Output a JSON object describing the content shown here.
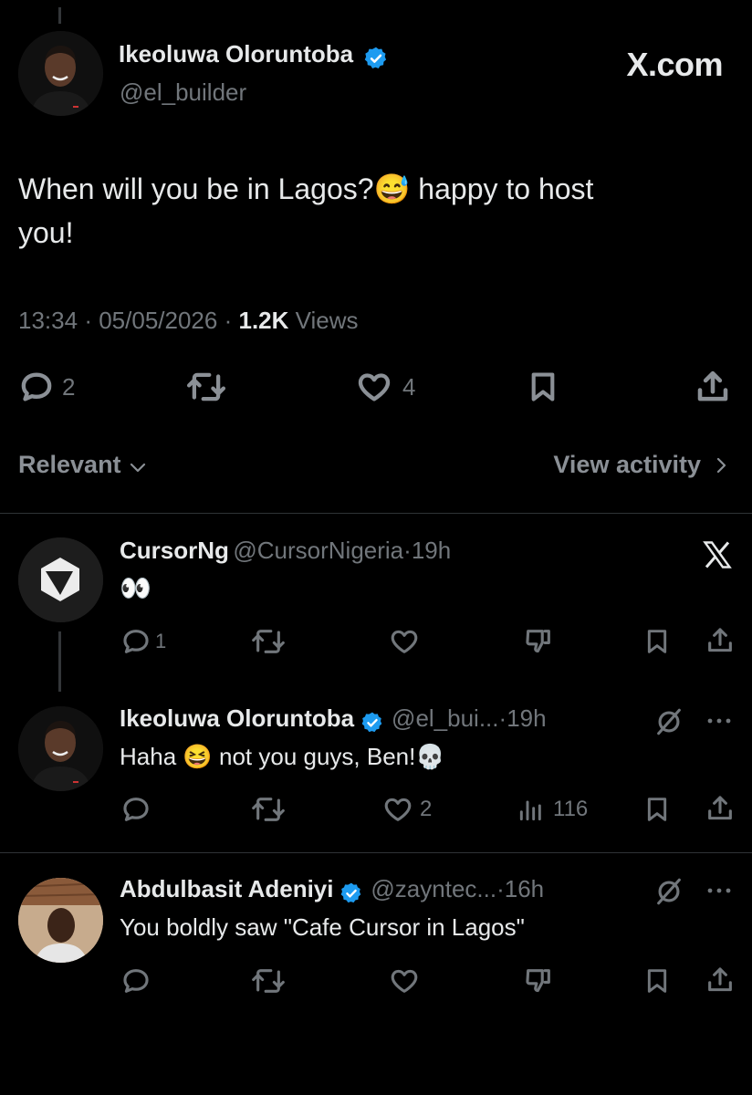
{
  "main_tweet": {
    "author_name": "Ikeoluwa Oloruntoba",
    "author_handle": "@el_builder",
    "watermark": "X.com",
    "text_line1_a": "When will you be in Lagos?",
    "emoji1": "😅",
    "text_line1_b": " happy to host",
    "text_line2": "you!",
    "time": "13:34",
    "date": "05/05/2026",
    "separator": "·",
    "views_count": "1.2K",
    "views_label": "Views",
    "replies": "2",
    "likes": "4",
    "sort_label": "Relevant",
    "view_activity_label": "View activity"
  },
  "replies": [
    {
      "author_name": "CursorNg",
      "author_handle": "@CursorNigeria",
      "time": "19h",
      "text": "👀",
      "reply_count": "1",
      "like_count": ""
    },
    {
      "author_name": "Ikeoluwa Oloruntoba",
      "author_handle": "@el_bui...",
      "time": "19h",
      "text_a": "Haha ",
      "emoji": "😆",
      "text_b": " not you guys, Ben!",
      "emoji2": "💀",
      "like_count": "2",
      "views_count": "116"
    },
    {
      "author_name": "Abdulbasit Adeniyi",
      "author_handle": "@zayntec...",
      "time": "16h",
      "text": "You boldly saw \"Cafe Cursor in Lagos\""
    }
  ],
  "colors": {
    "background": "#000000",
    "text": "#e7e9ea",
    "muted": "#71767b",
    "verified_blue": "#1d9bf0",
    "divider": "#2f3336"
  },
  "icons": [
    "reply-icon",
    "retweet-icon",
    "heart-icon",
    "bookmark-icon",
    "share-icon",
    "chevron-down-icon",
    "chevron-right-icon",
    "x-logo-icon",
    "grok-icon",
    "more-icon",
    "downvote-icon",
    "views-icon",
    "verified-badge-icon",
    "cursor-logo-icon"
  ]
}
